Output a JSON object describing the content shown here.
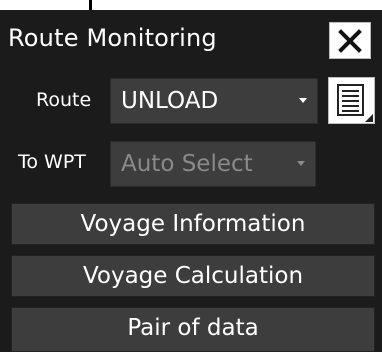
{
  "window": {
    "title": "Route Monitoring",
    "close_icon": "close-icon"
  },
  "route": {
    "label": "Route",
    "selected": "UNLOAD",
    "list_icon": "list-document-icon"
  },
  "to_wpt": {
    "label": "To WPT",
    "selected": "Auto Select"
  },
  "buttons": {
    "voyage_information": "Voyage Information",
    "voyage_calculation": "Voyage Calculation",
    "pair_of_data": "Pair of data"
  },
  "colors": {
    "panel_bg": "#1b1b1b",
    "button_bg": "#3d3d3d",
    "text": "#ffffff",
    "disabled_text": "#8a8a8a"
  }
}
